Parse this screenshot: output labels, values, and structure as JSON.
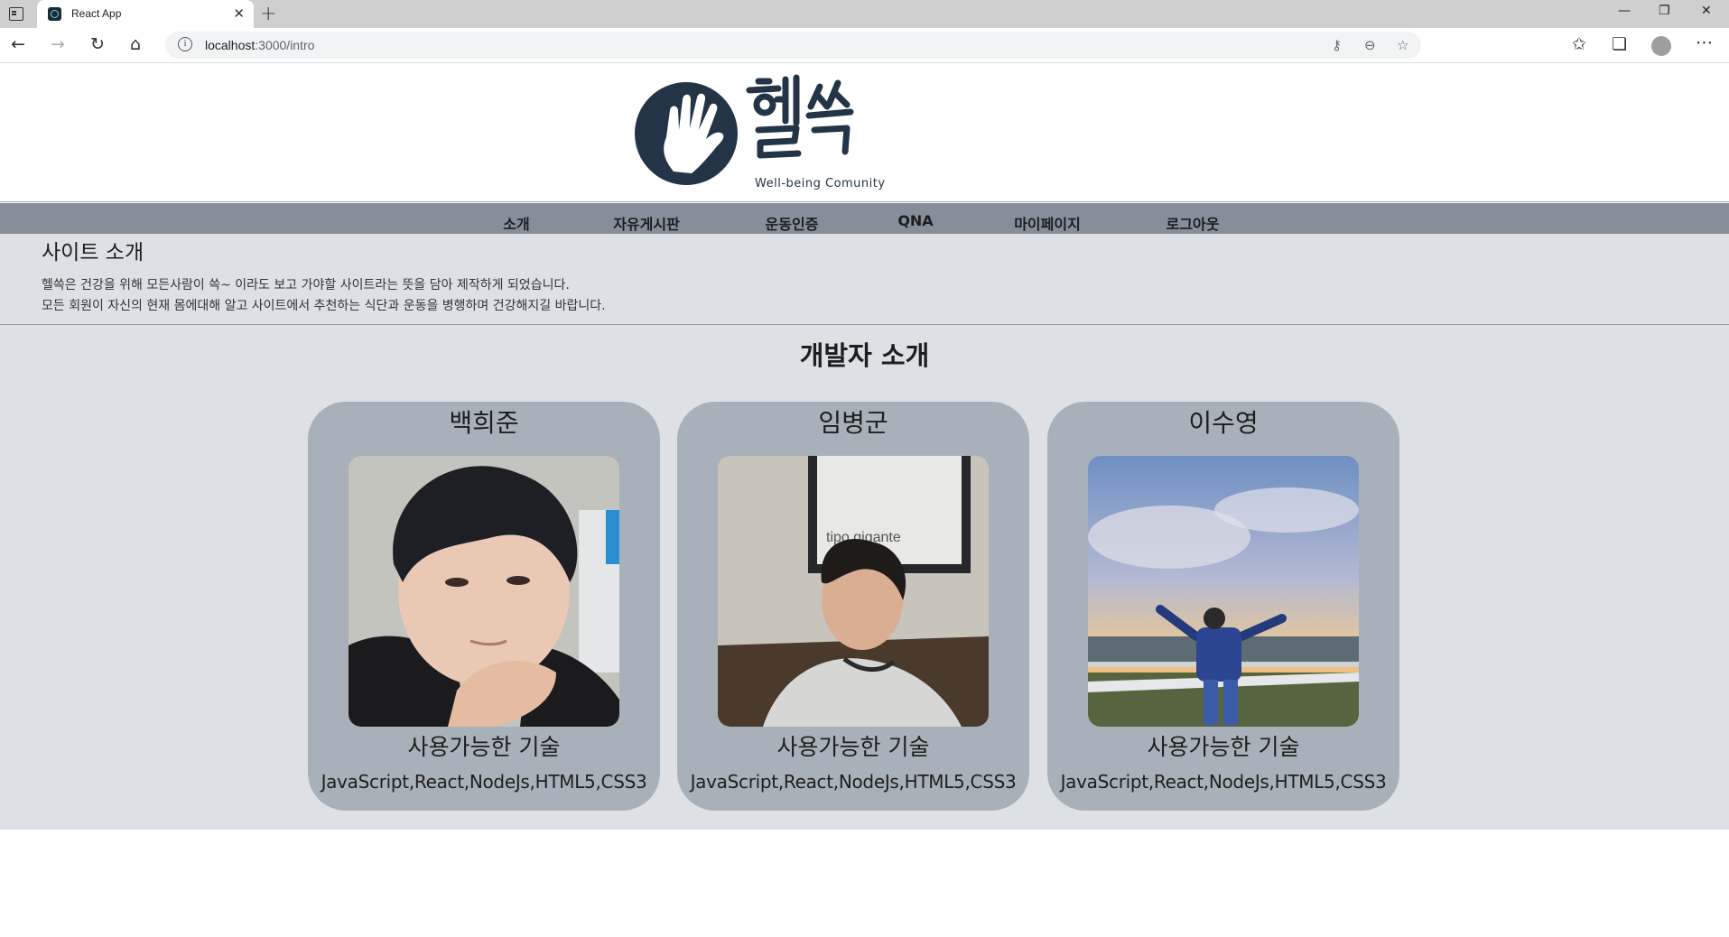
{
  "browser": {
    "tab_title": "React App",
    "url_host": "localhost",
    "url_path": ":3000/intro"
  },
  "site": {
    "logo_sub": "Well-being Comunity"
  },
  "nav": {
    "items": [
      {
        "label": "소개"
      },
      {
        "label": "자유게시판"
      },
      {
        "label": "운동인증"
      },
      {
        "label": "QNA"
      },
      {
        "label": "마이페이지"
      },
      {
        "label": "로그아웃"
      }
    ]
  },
  "intro": {
    "title": "사이트 소개",
    "line1": "헬쓱은 건강을 위해 모든사람이 쓱~ 이라도 보고 가야할 사이트라는 뜻을 담아 제작하게 되었습니다.",
    "line2": "모든 회원이 자신의 현재 몸에대해 알고 사이트에서 추천하는 식단과 운동을 병행하며 건강해지길 바랍니다."
  },
  "developers": {
    "heading": "개발자 소개",
    "members": [
      {
        "name": "백희준",
        "skills_title": "사용가능한 기술",
        "skills": "JavaScript,React,NodeJs,HTML5,CSS3"
      },
      {
        "name": "임병군",
        "skills_title": "사용가능한 기술",
        "skills": "JavaScript,React,NodeJs,HTML5,CSS3"
      },
      {
        "name": "이수영",
        "skills_title": "사용가능한 기술",
        "skills": "JavaScript,React,NodeJs,HTML5,CSS3"
      }
    ]
  },
  "colors": {
    "navbar": "#868f99",
    "content_bg": "#dde1e6",
    "card_bg": "#a8b1ba",
    "logo_navy": "#243447"
  }
}
